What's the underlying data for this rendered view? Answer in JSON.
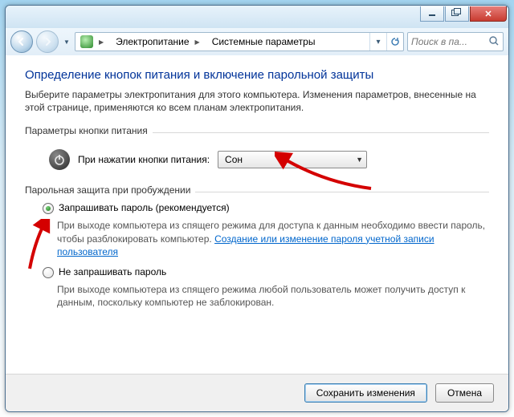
{
  "titlebar": {},
  "nav": {
    "crumb1": "Электропитание",
    "crumb2": "Системные параметры",
    "search_placeholder": "Поиск в па..."
  },
  "page": {
    "heading": "Определение кнопок питания и включение парольной защиты",
    "intro": "Выберите параметры электропитания для этого компьютера. Изменения параметров, внесенные на этой странице, применяются ко всем планам электропитания.",
    "group_power": "Параметры кнопки питания",
    "power_label": "При нажатии кнопки питания:",
    "power_value": "Сон",
    "group_password": "Парольная защита при пробуждении",
    "radio1_label": "Запрашивать пароль (рекомендуется)",
    "radio1_desc_a": "При выходе компьютера из спящего режима для доступа к данным необходимо ввести пароль, чтобы разблокировать компьютер. ",
    "radio1_link": "Создание или изменение пароля учетной записи пользователя",
    "radio2_label": "Не запрашивать пароль",
    "radio2_desc": "При выходе компьютера из спящего режима любой пользователь может получить доступ к данным, поскольку компьютер не заблокирован."
  },
  "footer": {
    "save": "Сохранить изменения",
    "cancel": "Отмена"
  }
}
